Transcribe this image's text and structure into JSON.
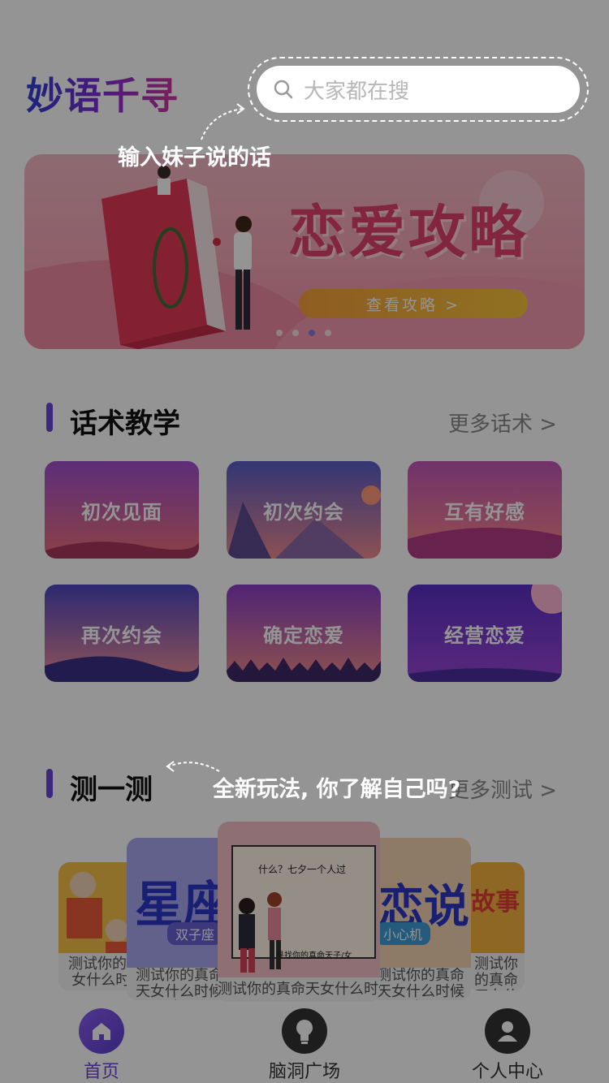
{
  "app": {
    "logo_text": "妙语千寻",
    "brand_color": "#6b45d7"
  },
  "search": {
    "placeholder": "大家都在搜",
    "icon": "search-icon"
  },
  "hints": {
    "search_hint": "输入妹子说的话",
    "test_hint": "全新玩法, 你了解自己吗?"
  },
  "banner": {
    "title": "恋爱攻略",
    "button_label": "查看攻略 >",
    "dot_count": 4,
    "active_dot": 3
  },
  "section_tactics": {
    "title": "话术教学",
    "more": "更多话术 >",
    "cards": [
      {
        "label": "初次见面"
      },
      {
        "label": "初次约会"
      },
      {
        "label": "互有好感"
      },
      {
        "label": "再次约会"
      },
      {
        "label": "确定恋爱"
      },
      {
        "label": "经营恋爱"
      }
    ]
  },
  "section_test": {
    "title": "测一测",
    "more": "更多测试 >",
    "cards": [
      {
        "caption": "测试你的真命天女什么时候来?",
        "art_text": ""
      },
      {
        "caption": "测试你的真命天女什么时候来?",
        "art_text": "星座",
        "sub_text": "双子座"
      },
      {
        "caption": "测试你的真命天女什么时候来?",
        "art_text": "什么？七夕一个人过",
        "sub_text": "寻找你的真命天子/女"
      },
      {
        "caption": "测试你的真命天女什么时候来?",
        "art_text": "恋说",
        "sub_text": "小心机"
      },
      {
        "caption": "测试你的真命天女什么时候来?",
        "art_text": "故事"
      }
    ]
  },
  "tabbar": {
    "tabs": [
      {
        "label": "首页",
        "icon": "home-icon",
        "active": true
      },
      {
        "label": "脑洞广场",
        "icon": "lightbulb-icon",
        "active": false
      },
      {
        "label": "个人中心",
        "icon": "user-icon",
        "active": false
      }
    ]
  }
}
